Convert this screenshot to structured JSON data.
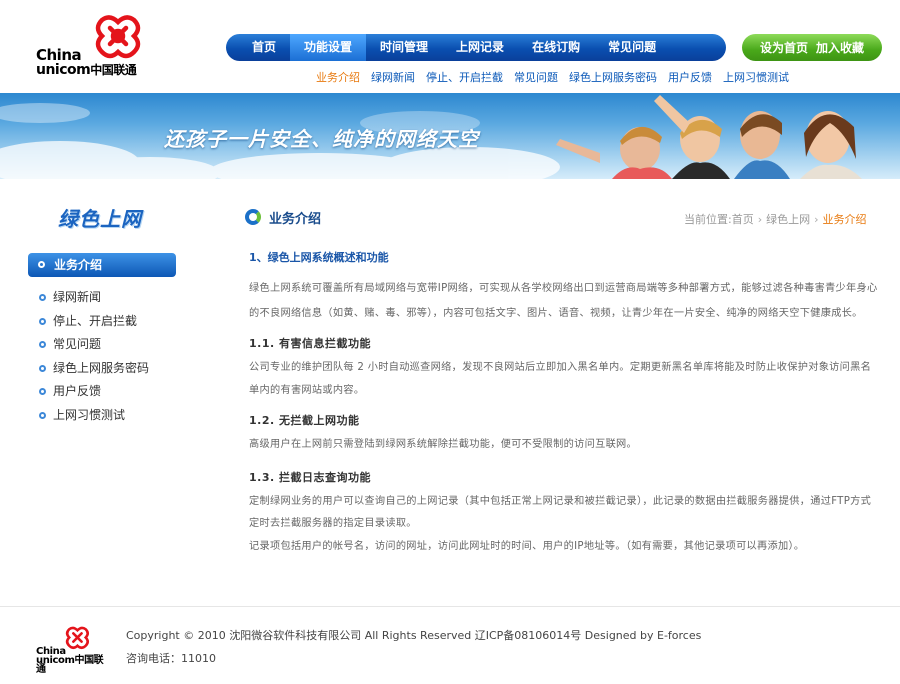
{
  "header": {
    "logo": {
      "line1": "China",
      "line2_en": "unicom",
      "line2_cn": "中国联通"
    },
    "main_nav": [
      {
        "label": "首页"
      },
      {
        "label": "功能设置",
        "active": true
      },
      {
        "label": "时间管理"
      },
      {
        "label": "上网记录"
      },
      {
        "label": "在线订购"
      },
      {
        "label": "常见问题"
      }
    ],
    "home_button": {
      "set_home": "设为首页",
      "add_fav": "加入收藏"
    },
    "sub_nav": [
      {
        "label": "业务介绍",
        "active": true
      },
      {
        "label": "绿网新闻"
      },
      {
        "label": "停止、开启拦截"
      },
      {
        "label": "常见问题"
      },
      {
        "label": "绿色上网服务密码"
      },
      {
        "label": "用户反馈"
      },
      {
        "label": "上网习惯测试"
      }
    ],
    "accent_color": "#0a4fb0",
    "sub_nav_active_color": "#e87a10"
  },
  "banner": {
    "slogan": "还孩子一片安全、纯净的网络天空"
  },
  "sidebar": {
    "title": "绿色上网",
    "active_item": "业务介绍",
    "items": [
      "绿网新闻",
      "停止、开启拦截",
      "常见问题",
      "绿色上网服务密码",
      "用户反馈",
      "上网习惯测试"
    ]
  },
  "content": {
    "heading": "业务介绍",
    "breadcrumb": {
      "prefix": "当前位置:",
      "home": "首页",
      "section": "绿色上网",
      "current": "业务介绍"
    },
    "section_title": "1、绿色上网系统概述和功能",
    "intro": "绿色上网系统可覆盖所有局域网络与宽带IP网络，可实现从各学校网络出口到运营商局端等多种部署方式，能够过滤各种毒害青少年身心的不良网络信息（如黄、赌、毒、邪等），内容可包括文字、图片、语音、视频，让青少年在一片安全、纯净的网络天空下健康成长。",
    "sub1_title": "1.1. 有害信息拦截功能",
    "sub1_text": "公司专业的维护团队每 2 小时自动巡查网络，发现不良网站后立即加入黑名单内。定期更新黑名单库将能及时防止收保护对象访问黑名单内的有害网站或内容。",
    "sub2_title": "1.2. 无拦截上网功能",
    "sub2_text": "高级用户在上网前只需登陆到绿网系统解除拦截功能，便可不受限制的访问互联网。",
    "sub3_title": "1.3. 拦截日志查询功能",
    "sub3_text1": "定制绿网业务的用户可以查询自己的上网记录（其中包括正常上网记录和被拦截记录），此记录的数据由拦截服务器提供，通过FTP方式定时去拦截服务器的指定目录读取。",
    "sub3_text2": "记录项包括用户的帐号名，访问的网址，访问此网址时的时间、用户的IP地址等。（如有需要，其他记录项可以再添加）。"
  },
  "footer": {
    "logo_line1": "China",
    "logo_line2": "unicom中国联通",
    "copyright": "Copyright © 2010  沈阳微谷软件科技有限公司  All Rights Reserved    辽ICP备08106014号    Designed by E-forces",
    "hotline": "咨询电话：11010"
  }
}
